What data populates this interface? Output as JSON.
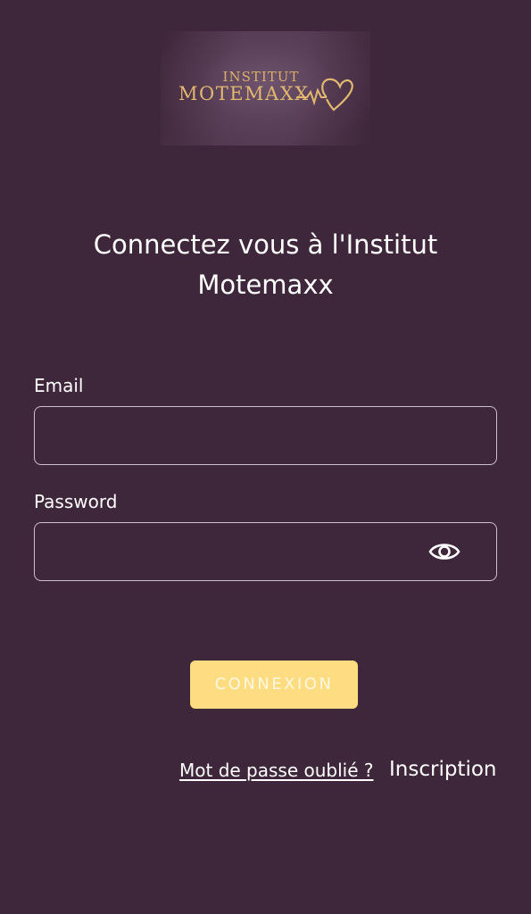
{
  "logo": {
    "line1": "INSTITUT",
    "line2": "MOTEMAXX"
  },
  "login": {
    "title": "Connectez vous à l'Institut Motemaxx",
    "email_label": "Email",
    "email_value": "",
    "password_label": "Password",
    "password_value": "",
    "submit_label": "CONNEXION",
    "forgot_label": "Mot de passe oublié ?",
    "signup_label": "Inscription"
  },
  "icons": {
    "password_toggle": "eye-icon",
    "logo_mark": "heart-pulse-icon"
  },
  "colors": {
    "background": "#3f273b",
    "button": "#fedc82",
    "button_text": "#fff7e0",
    "logo_gold": "#e1b870",
    "field_border": "#cdbfcb"
  }
}
